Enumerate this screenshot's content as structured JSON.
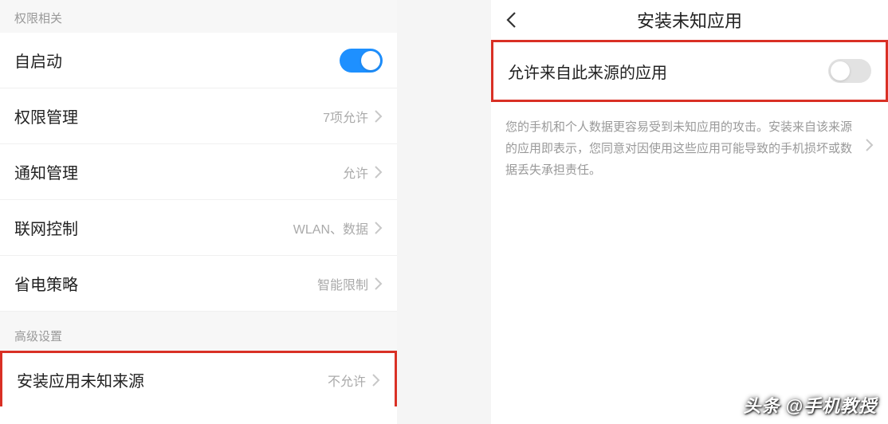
{
  "left": {
    "section1_title": "权限相关",
    "autostart_label": "自启动",
    "autostart_on": true,
    "permission_label": "权限管理",
    "permission_value": "7项允许",
    "notification_label": "通知管理",
    "notification_value": "允许",
    "network_label": "联网控制",
    "network_value": "WLAN、数据",
    "battery_label": "省电策略",
    "battery_value": "智能限制",
    "section2_title": "高级设置",
    "unknown_source_label": "安装应用未知来源",
    "unknown_source_value": "不允许"
  },
  "right": {
    "title": "安装未知应用",
    "allow_label": "允许来自此来源的应用",
    "allow_on": false,
    "info_text": "您的手机和个人数据更容易受到未知应用的攻击。安装来自该来源的应用即表示，您同意对因使用这些应用可能导致的手机损坏或数据丢失承担责任。"
  },
  "watermark": "头条 @手机教授"
}
